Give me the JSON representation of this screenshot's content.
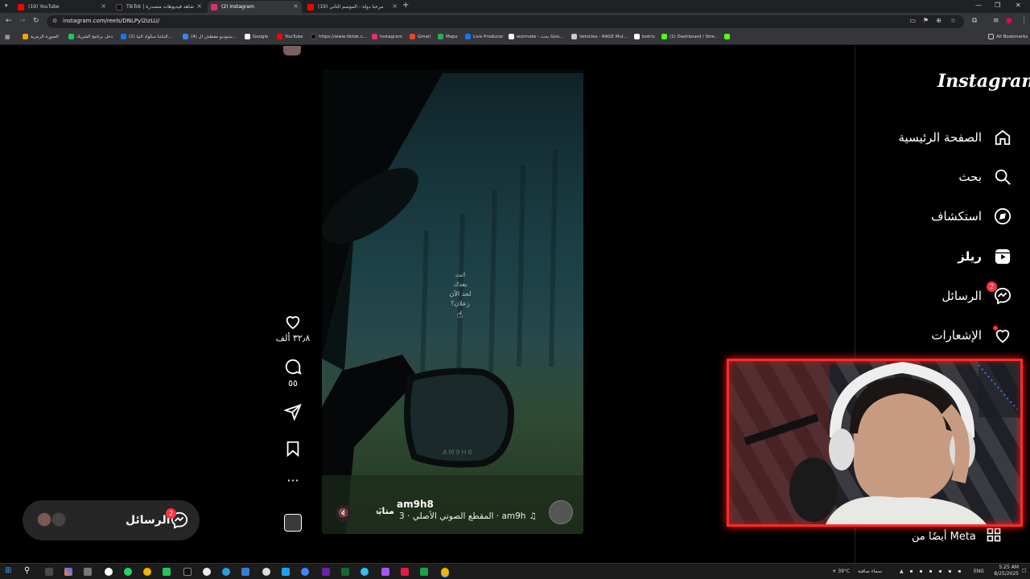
{
  "browser": {
    "tabs": [
      {
        "title": "(19) YouTube",
        "color": "#ff0000",
        "active": false
      },
      {
        "title": "TikTok | شاهد فيديوهات متصدرة",
        "color": "#111111",
        "active": false
      },
      {
        "title": "(2) Instagram",
        "color": "#e1306c",
        "active": true
      },
      {
        "title": "(19) مرحبا دولة - الموسم الثاني",
        "color": "#ff0000",
        "active": false
      }
    ],
    "new_tab_icon": "plus-icon",
    "url": "instagram.com/reels/DNLPyl2izLU/",
    "bookmarks": [
      {
        "label": "الصورة الرمزية",
        "color": "#f4a300"
      },
      {
        "label": "دخل برنامج الشريك",
        "color": "#22c55e"
      },
      {
        "label": "(2) الباشا سكواد البيا...",
        "color": "#1877f2"
      },
      {
        "label": "(4) ستوديو مقطش ال...",
        "color": "#3b82f6"
      },
      {
        "label": "Google",
        "color": "#ffffff"
      },
      {
        "label": "YouTube",
        "color": "#ff0000"
      },
      {
        "label": "https://www.tiktok.c...",
        "color": "#111111"
      },
      {
        "label": "Instagram",
        "color": "#e1306c"
      },
      {
        "label": "Gmail",
        "color": "#ea4335"
      },
      {
        "label": "Maps",
        "color": "#34a853"
      },
      {
        "label": "Live Producer",
        "color": "#1877f2"
      },
      {
        "label": "wormate - بحث Goo...",
        "color": "#ffffff"
      },
      {
        "label": "Vehicles - RAGE Mul...",
        "color": "#cccccc"
      },
      {
        "label": "botrix",
        "color": "#ffffff"
      },
      {
        "label": "(1) Dashboard / Stre...",
        "color": "#53fc18"
      }
    ],
    "all_bookmarks": "All Bookmarks"
  },
  "instagram": {
    "logo": "Instagram",
    "nav": [
      {
        "label": "الصفحة الرئيسية",
        "icon": "home-icon"
      },
      {
        "label": "بحث",
        "icon": "search-icon"
      },
      {
        "label": "استكشاف",
        "icon": "compass-icon"
      },
      {
        "label": "ريلز",
        "icon": "reels-icon"
      },
      {
        "label": "الرسائل",
        "icon": "messenger-icon",
        "badge": "2"
      },
      {
        "label": "الإشعارات",
        "icon": "heart-icon"
      }
    ],
    "also_from": "أيضًا من Meta"
  },
  "reel": {
    "caption_lines": [
      "انت",
      "بعدك",
      "لحد الآن",
      "زعلان؟"
    ],
    "watermark": "AM9H8",
    "username": "am9h8",
    "follow": "متابَعة",
    "audio": "am9h · المقطع الصوتي الأصلي · 3",
    "likes": "٣٢٫٨ ألف",
    "comments": "٥٥",
    "actions": [
      "like-icon",
      "comment-icon",
      "share-icon",
      "save-icon",
      "more-icon"
    ]
  },
  "messages_pill": {
    "label": "الرسائل",
    "badge": "2"
  },
  "taskbar": {
    "weather": "39°C",
    "weather_text": "سماء صافية",
    "lang": "ENG",
    "time": "5:25 AM",
    "date": "8/25/2025"
  }
}
